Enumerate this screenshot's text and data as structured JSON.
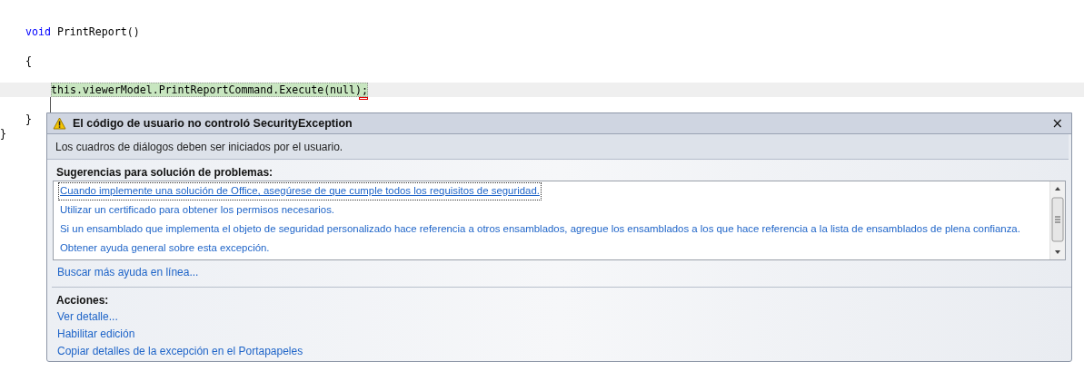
{
  "editor": {
    "lines": [
      {
        "children": [
          {
            "current": false,
            "tokens": [
              {
                "kind": "keyword",
                "text": "void"
              },
              {
                "kind": "plain",
                "text": " PrintReport()"
              }
            ]
          },
          {
            "current": false,
            "tokens": [
              {
                "kind": "plain",
                "text": "{"
              }
            ]
          },
          {
            "children": [
              {
                "current": true,
                "tokens": [
                  {
                    "kind": "statement",
                    "text": "this.viewerModel.PrintReportCommand.Execute(null);"
                  }
                ]
              }
            ]
          },
          {
            "current": false,
            "tokens": [
              {
                "kind": "plain",
                "text": "}"
              }
            ]
          }
        ]
      },
      {
        "current": false,
        "tokens": [
          {
            "kind": "plain",
            "text": "}"
          }
        ]
      }
    ]
  },
  "exception": {
    "title": "El código de usuario no controló SecurityException",
    "close": "×",
    "message": "Los cuadros de diálogos deben ser iniciados por el usuario.",
    "suggestions_heading": "Sugerencias para solución de problemas:",
    "suggestions": [
      {
        "text": "Cuando implemente una solución de Office, asegúrese de que cumple todos los requisitos de seguridad.",
        "selected": true
      },
      {
        "text": "Utilizar un certificado para obtener los permisos necesarios.",
        "selected": false
      },
      {
        "text": "Si un ensamblado que implementa el objeto de seguridad personalizado hace referencia a otros ensamblados, agregue los ensamblados a los que hace referencia a la lista de ensamblados de plena confianza.",
        "selected": false
      },
      {
        "text": "Obtener ayuda general sobre esta excepción.",
        "selected": false
      }
    ],
    "online_help": "Buscar más ayuda en línea...",
    "actions_heading": "Acciones:",
    "actions": [
      "Ver detalle...",
      "Habilitar edición",
      "Copiar detalles de la excepción en el Portapapeles"
    ]
  }
}
